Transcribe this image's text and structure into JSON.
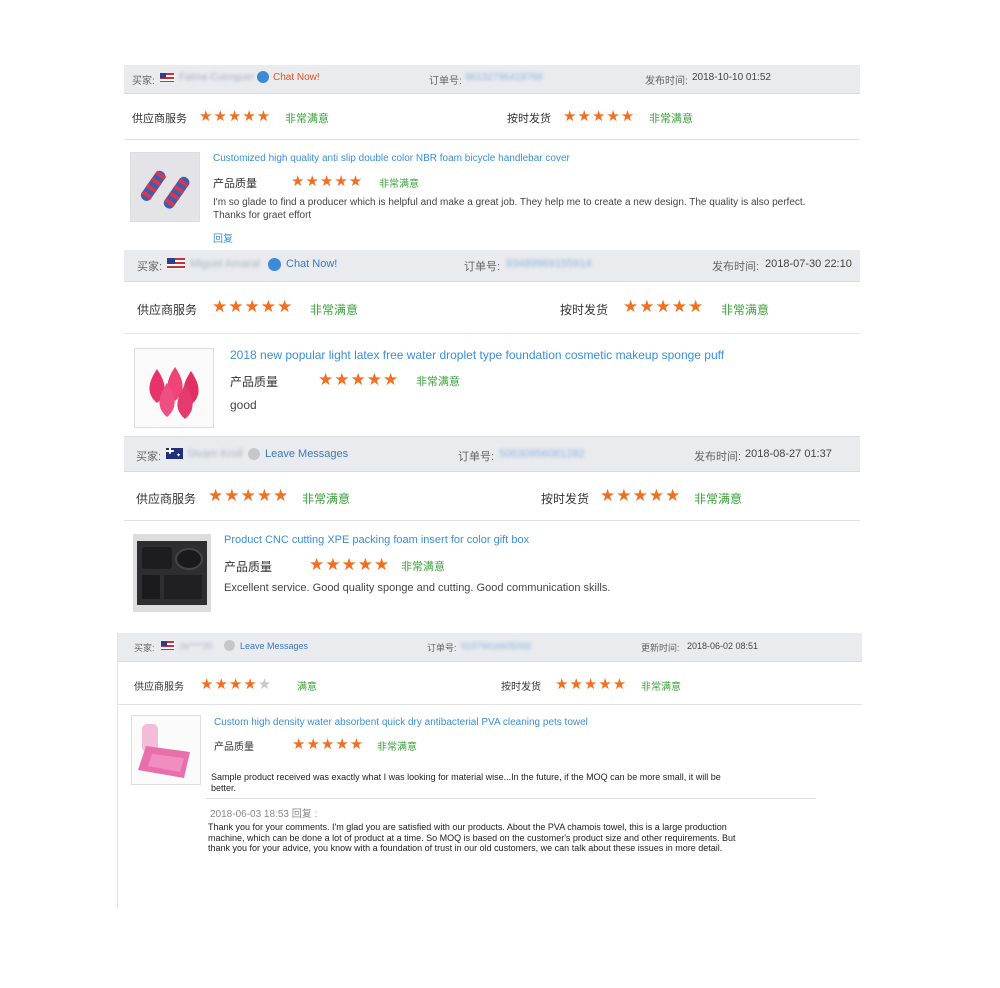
{
  "colors": {
    "star": "#f26f21",
    "satisfied": "#3aa03a",
    "link": "#3a8fd8",
    "header_bg": "#e9ebee"
  },
  "reviews": [
    {
      "buyer_label": "买家:",
      "buyer_name": "Fatma Cuenguer",
      "flag": "flag-us-icon",
      "contact": "Chat Now!",
      "order_label": "订单号:",
      "order_no": "96132796419766",
      "date_label": "发布时间:",
      "date": "2018-10-10 01:52",
      "supplier_label": "供应商服务",
      "supplier_stars": 5,
      "supplier_rating": "非常满意",
      "ship_label": "按时发货",
      "ship_stars": 5,
      "ship_rating": "非常满意",
      "product_title": "Customized high quality anti slip double color NBR foam bicycle handlebar cover",
      "quality_label": "产品质量",
      "quality_stars": 5,
      "quality_rating": "非常满意",
      "comment": "I'm so glade to find a producer which is helpful and make a great job. They help me to create a new design. The quality is also perfect. Thanks for graet effort",
      "reply_link": "回复"
    },
    {
      "buyer_label": "买家:",
      "buyer_name": "Miguel Amaral",
      "flag": "flag-us-icon",
      "contact": "Chat Now!",
      "order_label": "订单号:",
      "order_no": "93489969155914",
      "date_label": "发布时间:",
      "date": "2018-07-30 22:10",
      "supplier_label": "供应商服务",
      "supplier_stars": 5,
      "supplier_rating": "非常满意",
      "ship_label": "按时发货",
      "ship_stars": 5,
      "ship_rating": "非常满意",
      "product_title": "2018 new popular light latex free water droplet type foundation cosmetic makeup sponge puff",
      "quality_label": "产品质量",
      "quality_stars": 5,
      "quality_rating": "非常满意",
      "comment": "good"
    },
    {
      "buyer_label": "买家:",
      "buyer_name": "Sivam Kroll",
      "flag": "flag-au-icon",
      "contact": "Leave Messages",
      "order_label": "订单号:",
      "order_no": "50630956081282",
      "date_label": "发布时间:",
      "date": "2018-08-27 01:37",
      "supplier_label": "供应商服务",
      "supplier_stars": 5,
      "supplier_rating": "非常满意",
      "ship_label": "按时发货",
      "ship_stars": 5,
      "ship_rating": "非常满意",
      "product_title": "Product CNC cutting XPE packing foam insert for color gift box",
      "quality_label": "产品质量",
      "quality_stars": 5,
      "quality_rating": "非常满意",
      "comment": "Excellent service. Good quality sponge and cutting. Good communication skills."
    },
    {
      "buyer_label": "买家:",
      "buyer_name": "Ja****35",
      "flag": "flag-us-icon",
      "contact": "Leave Messages",
      "order_label": "订单号:",
      "order_no": "91979416605066",
      "date_label": "更新时间:",
      "date": "2018-06-02 08:51",
      "supplier_label": "供应商服务",
      "supplier_stars": 4,
      "supplier_rating": "满意",
      "ship_label": "按时发货",
      "ship_stars": 5,
      "ship_rating": "非常满意",
      "product_title": "Custom high density water absorbent quick dry antibacterial PVA cleaning pets towel",
      "quality_label": "产品质量",
      "quality_stars": 5,
      "quality_rating": "非常满意",
      "comment": "Sample product received was exactly what I was looking for material wise...In the future, if the MOQ can be more small, it will be better.",
      "reply_meta": "2018-06-03 18:53  回复 :",
      "reply_text": "Thank you for your comments. I'm glad you are satisfied with our products. About the PVA chamois towel, this is a large production machine, which can be done a lot of product at a time. So MOQ is based on the customer's product size and other requirements. But thank you for your advice, you know with a foundation of trust in our old customers, we can talk about these issues in more detail."
    }
  ]
}
